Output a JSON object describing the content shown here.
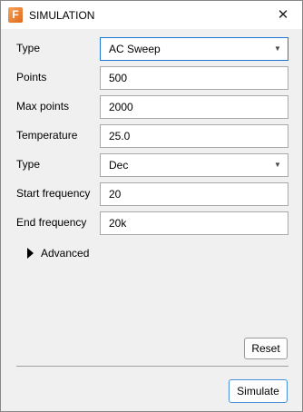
{
  "window": {
    "title": "SIMULATION",
    "app_icon": "app-logo-icon",
    "app_icon_letter": "F",
    "close_glyph": "✕"
  },
  "form": {
    "type": {
      "label": "Type",
      "value": "AC Sweep"
    },
    "points": {
      "label": "Points",
      "value": "500"
    },
    "max_points": {
      "label": "Max points",
      "value": "2000"
    },
    "temperature": {
      "label": "Temperature",
      "value": "25.0"
    },
    "sweep_type": {
      "label": "Type",
      "value": "Dec"
    },
    "start_frequency": {
      "label": "Start frequency",
      "value": "20"
    },
    "end_frequency": {
      "label": "End frequency",
      "value": "20k"
    }
  },
  "advanced": {
    "label": "Advanced",
    "expanded": false
  },
  "buttons": {
    "reset": "Reset",
    "simulate": "Simulate"
  },
  "colors": {
    "accent": "#1f78d1",
    "icon_orange": "#e26a1c"
  },
  "dropdown_glyph": "▼"
}
